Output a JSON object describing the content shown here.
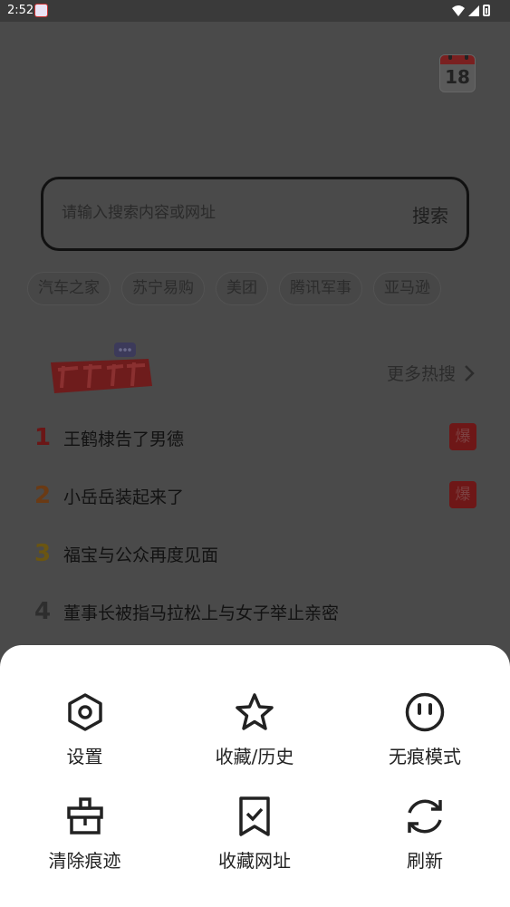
{
  "status_bar": {
    "time": "2:52",
    "icons": [
      "app-notification-icon",
      "wifi-icon",
      "signal-icon",
      "battery-icon"
    ]
  },
  "calendar": {
    "day": "18"
  },
  "search": {
    "placeholder": "请输入搜索内容或网址",
    "button_label": "搜索"
  },
  "quick_links": [
    "汽车之家",
    "苏宁易购",
    "美团",
    "腾讯军事",
    "亚马逊"
  ],
  "hot_search": {
    "logo_icon": "weibo-hot-search-logo",
    "more_label": "更多热搜",
    "items": [
      {
        "rank": "1",
        "title": "王鹤棣告了男德",
        "badge": "爆",
        "rank_color": "#6b1616"
      },
      {
        "rank": "2",
        "title": "小岳岳装起来了",
        "badge": "爆",
        "rank_color": "#6a3a14"
      },
      {
        "rank": "3",
        "title": "福宝与公众再度见面",
        "badge": "",
        "rank_color": "#6a5512"
      },
      {
        "rank": "4",
        "title": "董事长被指马拉松上与女子举止亲密",
        "badge": "",
        "rank_color": "#2e2e2e"
      }
    ]
  },
  "menu": {
    "items": [
      {
        "label": "设置",
        "icon": "settings-icon"
      },
      {
        "label": "收藏/历史",
        "icon": "star-icon"
      },
      {
        "label": "无痕模式",
        "icon": "incognito-icon"
      },
      {
        "label": "清除痕迹",
        "icon": "clear-icon"
      },
      {
        "label": "收藏网址",
        "icon": "bookmark-icon"
      },
      {
        "label": "刷新",
        "icon": "refresh-icon"
      }
    ]
  }
}
